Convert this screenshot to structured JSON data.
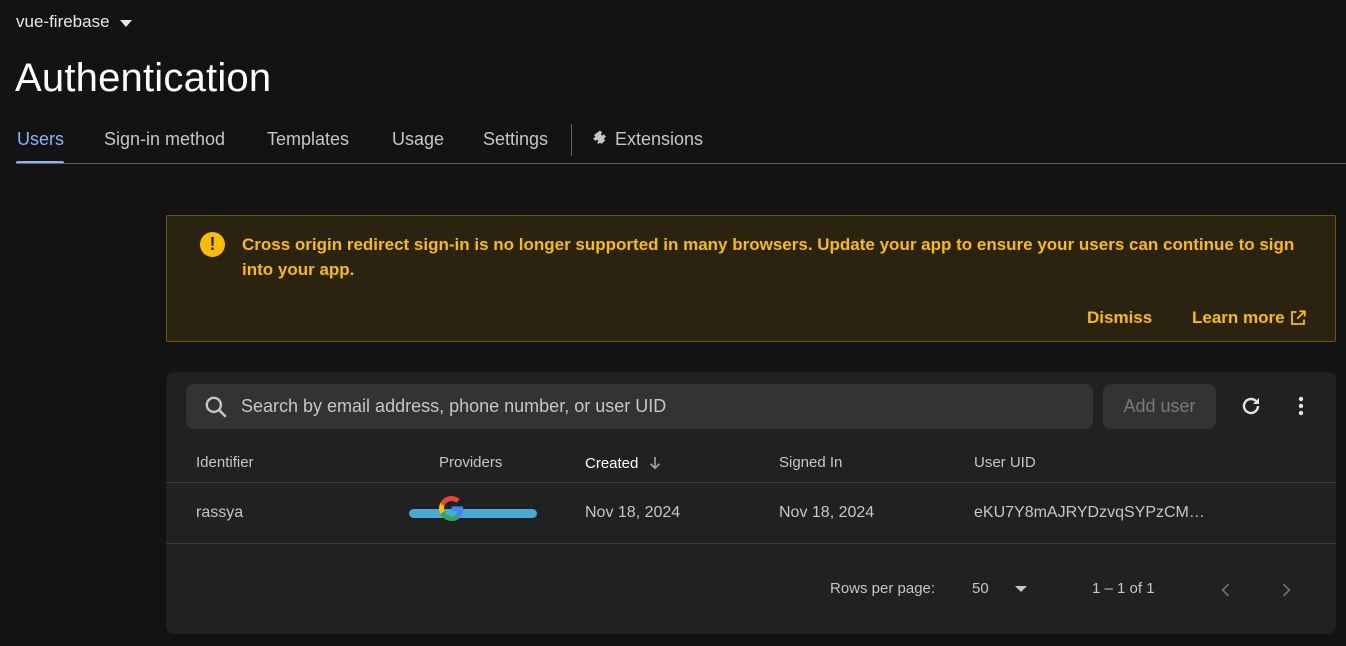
{
  "project": {
    "name": "vue-firebase",
    "icon": "caret-down-icon"
  },
  "page": {
    "title": "Authentication"
  },
  "tabs": [
    {
      "label": "Users",
      "active": true
    },
    {
      "label": "Sign-in method"
    },
    {
      "label": "Templates"
    },
    {
      "label": "Usage"
    },
    {
      "label": "Settings"
    },
    {
      "label": "Extensions",
      "icon": "puzzle-icon"
    }
  ],
  "banner": {
    "icon": "warning-icon",
    "icon_glyph": "!",
    "message": "Cross origin redirect sign-in is no longer supported in many browsers. Update your app to ensure your users can continue to sign into your app.",
    "dismiss_label": "Dismiss",
    "learn_more_label": "Learn more",
    "learn_more_icon": "external-link-icon",
    "color": "#fbbc04"
  },
  "toolbar": {
    "search_placeholder": "Search by email address, phone number, or user UID",
    "add_user_label": "Add user",
    "refresh_icon": "refresh-icon",
    "menu_icon": "more-vert-icon"
  },
  "table": {
    "columns": [
      "Identifier",
      "Providers",
      "Created",
      "Signed In",
      "User UID"
    ],
    "sorted_column": "Created",
    "sort_icon": "arrow-down-icon",
    "rows": [
      {
        "identifier": "rassya",
        "provider": "google-icon",
        "created": "Nov 18, 2024",
        "signed_in": "Nov 18, 2024",
        "uid": "eKU7Y8mAJRYDzvqSYPzCM…"
      }
    ]
  },
  "pagination": {
    "rows_per_page_label": "Rows per page:",
    "rows_per_page": "50",
    "range": "1 – 1 of 1",
    "prev_icon": "chevron-left-icon",
    "next_icon": "chevron-right-icon"
  },
  "colors": {
    "accent": "#8ab4f8",
    "background": "#131313",
    "card": "#212121"
  }
}
